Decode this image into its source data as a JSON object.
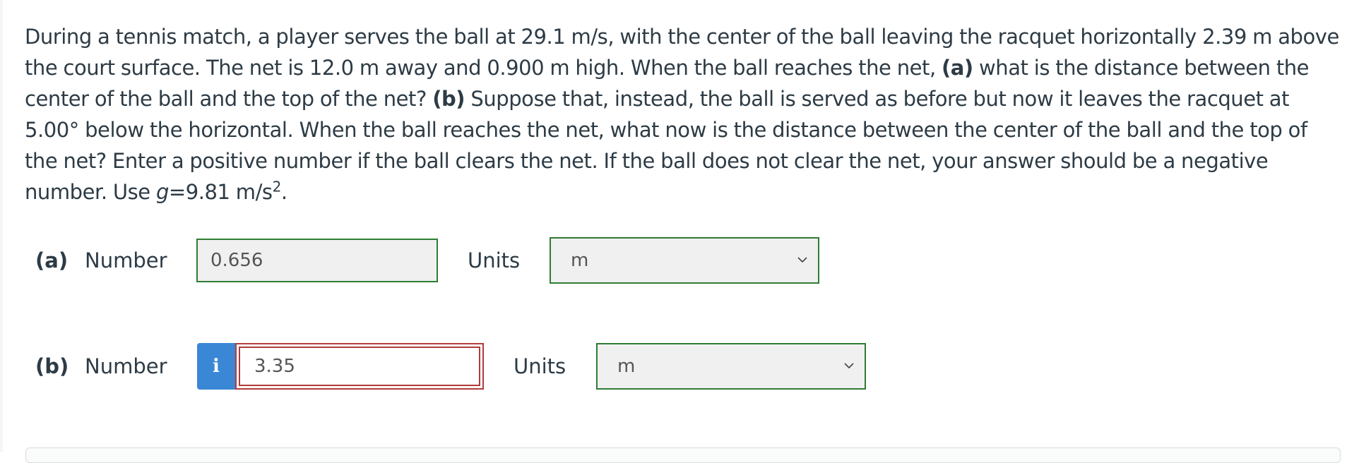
{
  "question": {
    "text_1": "During a tennis match, a player serves the ball at 29.1 m/s, with the center of the ball leaving the racquet horizontally 2.39 m above the court surface. The net is 12.0 m away and 0.900 m high. When the ball reaches the net, ",
    "part_a_marker": "(a)",
    "text_2": " what is the distance between the center of the ball and the top of the net? ",
    "part_b_marker": "(b)",
    "text_3": " Suppose that, instead, the ball is served as before but now it leaves the racquet at 5.00° below the horizontal. When the ball reaches the net, what now is the distance between the center of the ball and the top of the net? Enter a positive number if the ball clears the net. If the ball does not clear the net, your answer should be a negative number. Use ",
    "g_symbol": "g",
    "g_value": "=9.81 m/s",
    "g_exponent": "2",
    "end": "."
  },
  "part_a": {
    "label": "(a)",
    "number_label": "Number",
    "number_value": "0.656",
    "units_label": "Units",
    "units_value": "m"
  },
  "part_b": {
    "label": "(b)",
    "number_label": "Number",
    "info_icon": "i",
    "number_value": "3.35",
    "units_label": "Units",
    "units_value": "m"
  },
  "colors": {
    "correct_border": "#2e7d32",
    "incorrect_border": "#b23b3b",
    "info_button": "#3a87d6"
  }
}
